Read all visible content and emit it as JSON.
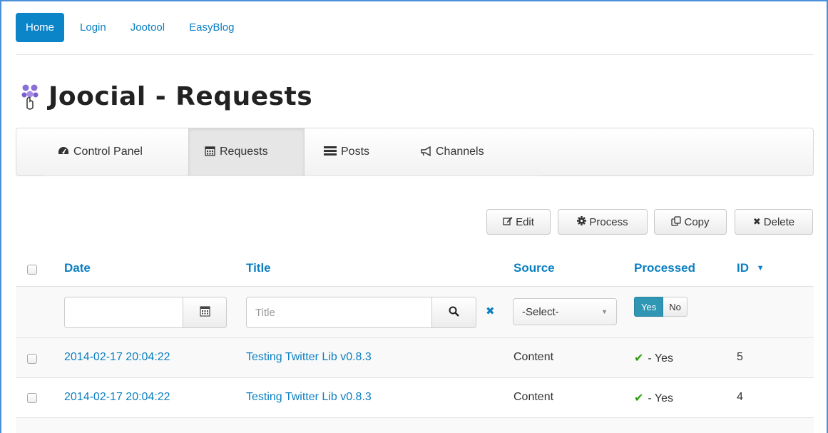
{
  "topnav": {
    "items": [
      {
        "label": "Home"
      },
      {
        "label": "Login"
      },
      {
        "label": "Jootool"
      },
      {
        "label": "EasyBlog"
      }
    ]
  },
  "page": {
    "title": "Joocial - Requests"
  },
  "subnav": {
    "tabs": [
      {
        "label": "Control Panel",
        "icon": "dashboard-icon"
      },
      {
        "label": "Requests",
        "icon": "calendar-icon"
      },
      {
        "label": "Posts",
        "icon": "list-icon"
      },
      {
        "label": "Channels",
        "icon": "bullhorn-icon"
      }
    ],
    "active": "Requests"
  },
  "toolbar": {
    "edit": "Edit",
    "process": "Process",
    "copy": "Copy",
    "delete": "Delete"
  },
  "table": {
    "headers": {
      "date": "Date",
      "title": "Title",
      "source": "Source",
      "processed": "Processed",
      "id": "ID"
    },
    "filters": {
      "date_value": "",
      "title_placeholder": "Title",
      "source_selected": "-Select-",
      "processed_yes": "Yes",
      "processed_no": "No"
    },
    "rows": [
      {
        "date": "2014-02-17 20:04:22",
        "title": "Testing Twitter Lib v0.8.3",
        "source": "Content",
        "processed": "- Yes",
        "id": "5"
      },
      {
        "date": "2014-02-17 20:04:22",
        "title": "Testing Twitter Lib v0.8.3",
        "source": "Content",
        "processed": "- Yes",
        "id": "4"
      }
    ]
  },
  "colors": {
    "link": "#0b7fc1",
    "primary": "#0b84c8",
    "toggle_active": "#2f96b4",
    "check": "#2e9e0b"
  }
}
